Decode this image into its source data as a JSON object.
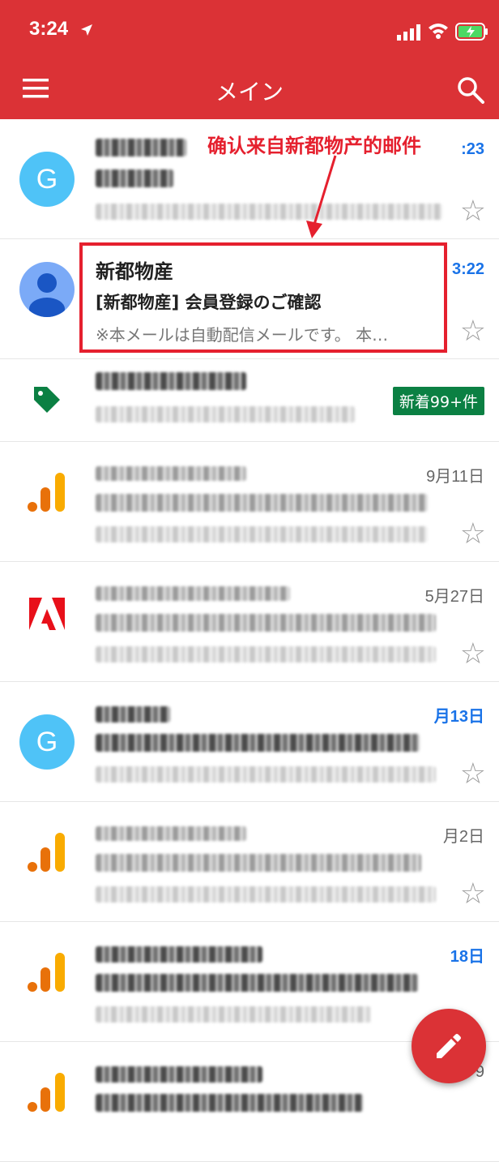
{
  "status": {
    "time": "3:24"
  },
  "header": {
    "title": "メイン"
  },
  "annotation": {
    "text": "确认来自新都物产的邮件"
  },
  "emails": [
    {
      "time": ":23"
    },
    {
      "sender": "新都物産",
      "subject": "[新都物産] 会員登録のご確認",
      "snippet": "※本メールは自動配信メールです。 本…",
      "time": "3:22"
    },
    {
      "badge": "新着99+件"
    },
    {
      "time": "9月11日"
    },
    {
      "time": "5月27日"
    },
    {
      "time": "月13日"
    },
    {
      "time": "月2日"
    },
    {
      "time": "18日"
    },
    {
      "time": "9"
    }
  ],
  "colors": {
    "appbar": "#db3236",
    "highlight": "#e5202e",
    "badge": "#0b8043",
    "link": "#1a73e8"
  }
}
